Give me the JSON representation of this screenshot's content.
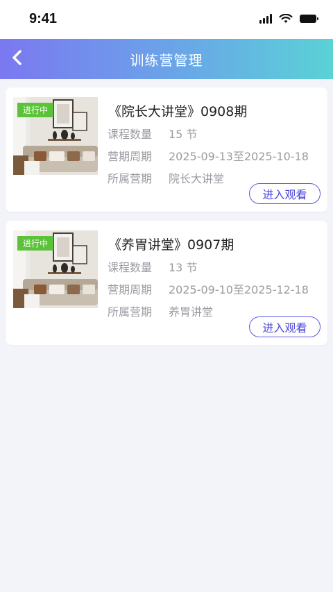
{
  "status_bar": {
    "time": "9:41"
  },
  "nav": {
    "title": "训练营管理"
  },
  "labels": {
    "course_count": "课程数量",
    "period": "营期周期",
    "camp": "所属营期"
  },
  "cards": [
    {
      "badge": "进行中",
      "title": "《院长大讲堂》0908期",
      "course_count": "15 节",
      "period": "2025-09-13至2025-10-18",
      "camp": "院长大讲堂",
      "button": "进入观看"
    },
    {
      "badge": "进行中",
      "title": "《养胃讲堂》0907期",
      "course_count": "13 节",
      "period": "2025-09-10至2025-12-18",
      "camp": "养胃讲堂",
      "button": "进入观看"
    }
  ]
}
